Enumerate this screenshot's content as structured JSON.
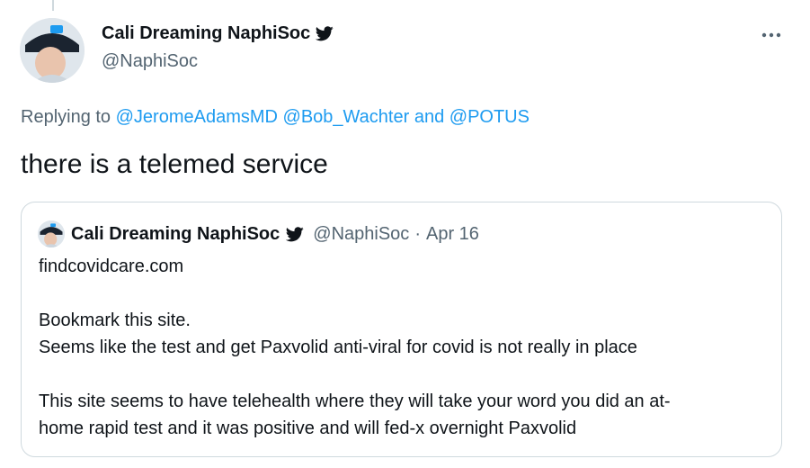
{
  "tweet": {
    "author_name": "Cali Dreaming NaphiSoc",
    "author_handle": "@NaphiSoc",
    "replying_prefix": "Replying to",
    "mentions": [
      "@JeromeAdamsMD",
      "@Bob_Wachter"
    ],
    "mentions_and": "and",
    "mention_last": "@POTUS",
    "text": "there is a telemed service",
    "more_icon": "more-horizontal-icon",
    "verified_icon": "twitter-bird-icon"
  },
  "quote": {
    "author_name": "Cali Dreaming NaphiSoc",
    "author_handle": "@NaphiSoc",
    "separator": "·",
    "date": "Apr 16",
    "lines": [
      "findcovidcare.com",
      "Bookmark this site.",
      "Seems like the test and get Paxvolid anti-viral for covid is not really in place",
      "This site seems to have telehealth where they will take your word you did an at-",
      "home rapid test and it was positive and will fed-x overnight Paxvolid"
    ]
  },
  "colors": {
    "text": "#0f1419",
    "secondary": "#536471",
    "link": "#1d9bf0",
    "border": "#cfd9de"
  }
}
